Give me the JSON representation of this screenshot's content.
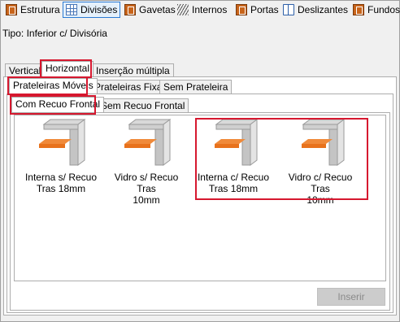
{
  "toolbar": {
    "tabs": [
      {
        "label": "Estrutura",
        "icon": "wood-panel-icon"
      },
      {
        "label": "Divisões",
        "icon": "grid-icon"
      },
      {
        "label": "Gavetas",
        "icon": "wood-panel-icon"
      },
      {
        "label": "Internos",
        "icon": "stripes-icon"
      },
      {
        "label": "Portas",
        "icon": "wood-panel-icon"
      },
      {
        "label": "Deslizantes",
        "icon": "book-icon"
      },
      {
        "label": "Fundos",
        "icon": "wood-panel-icon"
      }
    ],
    "active": "Divisões"
  },
  "tipo": "Tipo: Inferior c/ Divisória",
  "orientation_tabs": [
    "Vertical",
    "Horizontal",
    "Inserção múltipla"
  ],
  "orientation_selected": "Horizontal",
  "shelf_tabs": [
    "Prateleiras Móveis",
    "Prateleiras Fixas",
    "Sem Prateleira"
  ],
  "shelf_selected": "Prateleiras Móveis",
  "recuo_tabs": [
    "Com Recuo Frontal",
    "Sem Recuo Frontal"
  ],
  "recuo_selected": "Com Recuo Frontal",
  "items": [
    {
      "line1": "Interna s/ Recuo",
      "line2": "Tras 18mm"
    },
    {
      "line1": "Vidro s/ Recuo Tras",
      "line2": "10mm"
    },
    {
      "line1": "Interna c/ Recuo",
      "line2": "Tras 18mm"
    },
    {
      "line1": "Vidro c/ Recuo Tras",
      "line2": "10mm"
    }
  ],
  "insert_button": "Inserir",
  "colors": {
    "highlight": "#d6182f",
    "accent": "#2a7bd4",
    "shelf": "#e8721c"
  }
}
